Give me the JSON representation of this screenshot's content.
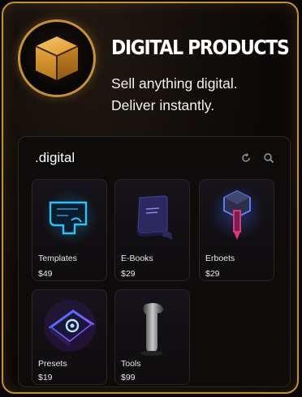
{
  "header": {
    "title": "DIGITAL PRODUCTS",
    "tagline_line1": "Sell anything digital.",
    "tagline_line2": "Deliver instantly.",
    "logo_icon": "box-icon",
    "accent_color": "#c8902f"
  },
  "panel": {
    "title": ".digital",
    "icons": [
      "refresh-icon",
      "search-icon"
    ],
    "products": [
      {
        "name": "Templates",
        "price": "$49",
        "icon": "template-icon",
        "color": "#27c3ff"
      },
      {
        "name": "E-Books",
        "price": "$29",
        "icon": "book-icon",
        "color": "#6a62c8"
      },
      {
        "name": "Erboets",
        "price": "$29",
        "icon": "hex-pin-icon",
        "color": "#e0357a"
      },
      {
        "name": "Presets",
        "price": "$19",
        "icon": "preset-icon",
        "color": "#b347ff"
      },
      {
        "name": "Tools",
        "price": "$99",
        "icon": "tool-icon",
        "color": "#9a9a9a"
      }
    ]
  }
}
